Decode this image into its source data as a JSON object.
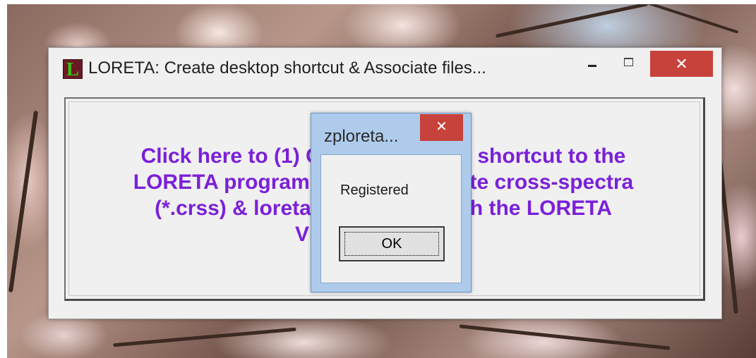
{
  "main_window": {
    "icon_letter": "L",
    "title": "LORETA: Create desktop shortcut & Associate files...",
    "minimize_label": "–",
    "maximize_label": "",
    "close_label": "✕",
    "message_lines": [
      "Click here to (1) C",
      "LORETA program",
      "(*.crss) & loreta",
      "V"
    ],
    "message_lines_right": [
      "p shortcut to the",
      "ate cross-spectra",
      "th the LORETA",
      ""
    ]
  },
  "dialog": {
    "title": "zploreta...",
    "close_label": "✕",
    "message": "Registered",
    "ok_label": "OK"
  },
  "colors": {
    "message_text": "#7b20d8",
    "close_button": "#c7423b",
    "dialog_frame": "#aecbec"
  }
}
